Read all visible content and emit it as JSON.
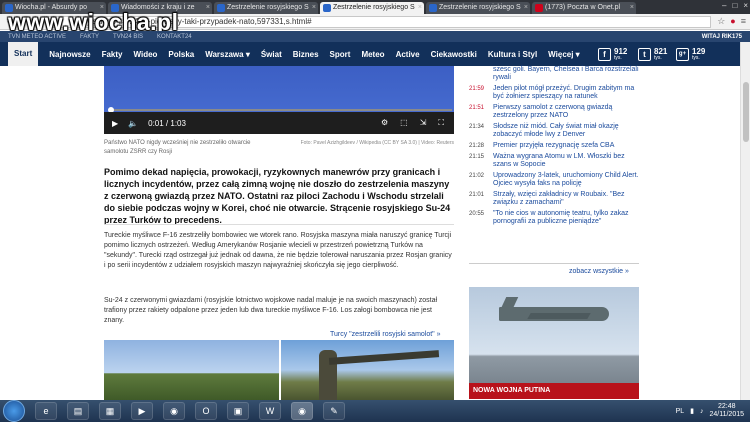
{
  "browser": {
    "tabs": [
      {
        "label": "Wiocha.pl - Absurdy po",
        "active": false
      },
      {
        "label": "Wiadomości z kraju i ze",
        "active": false
      },
      {
        "label": "Zestrzelenie rosyjskiego S",
        "active": false
      },
      {
        "label": "Zestrzelenie rosyjskiego S",
        "active": true
      },
      {
        "label": "Zestrzelenie rosyjskiego S",
        "active": false
      },
      {
        "label": "(1773) Poczta w Onet.pl",
        "active": false
      }
    ],
    "url": "yjskiego-su-24-to-pierwszy-taki-przypadek-nato,597331,s.html#"
  },
  "watermark": "www.wiocha.pl",
  "topstrip": {
    "items": [
      "TVN METEO ACTIVE",
      "FAKTY",
      "TVN24 BIS",
      "KONTAKT24"
    ],
    "greeting": "WITAJ RIK175"
  },
  "nav": {
    "start": "Start",
    "items": [
      "Najnowsze",
      "Fakty",
      "Wideo",
      "Polska",
      "Warszawa ▾",
      "Świat",
      "Biznes",
      "Sport",
      "Meteo",
      "Active",
      "Ciekawostki",
      "Kultura i Styl",
      "Więcej ▾"
    ],
    "social": [
      {
        "icon": "f",
        "count": "912",
        "unit": "tys."
      },
      {
        "icon": "t",
        "count": "821",
        "unit": "tys."
      },
      {
        "icon": "g+",
        "count": "129",
        "unit": "tys."
      }
    ]
  },
  "video": {
    "time": "0:01 / 1:03"
  },
  "caption": {
    "text": "Państwo NATO nigdy wcześniej nie zestrzeliło otwarcie samolotu ZSRR czy Rosji",
    "credit": "Foto: Pavel Azizhgildeev / Wikipedia (CC BY SA 3.0) | Video: Reuters"
  },
  "lead": "Pomimo dekad napięcia, prowokacji, ryzykownych manewrów przy granicach i licznych incydentów, przez całą zimną wojnę nie doszło do zestrzelenia maszyny z czerwoną gwiazdą przez NATO. Ostatni raz piloci Zachodu i Wschodu strzelali do siebie podczas wojny w Korei, choć nie otwarcie. Strącenie rosyjskiego Su-24 przez Turków to precedens.",
  "paragraph1": "Tureckie myśliwce F-16 zestrzeliły bombowiec we wtorek rano. Rosyjska maszyna miała naruszyć granicę Turcji pomimo licznych ostrzeżeń. Według Amerykanów Rosjanie wlecieli w przestrzeń powietrzną Turków na \"sekundy\". Turecki rząd ostrzegał już jednak od dawna, że nie będzie tolerował naruszania przez Rosjan granicy i po serii incydentów z udziałem rosyjskich maszyn najwyraźniej skończyła się jego cierpliwość.",
  "paragraph2": "Su-24 z czerwonymi gwiazdami (rosyjskie lotnictwo wojskowe nadal maluje je na swoich maszynach) został trafiony przez rakiety odpalone przez jeden lub dwa tureckie myśliwce F-16. Los załogi bombowca nie jest znany.",
  "related_link": "Turcy \"zestrzelili rosyjski samolot\" »",
  "news": [
    {
      "time": "",
      "title": "szesc goli. Bayern, Chelsea i Barca rozstrzelali rywali",
      "red": false
    },
    {
      "time": "21:59",
      "title": "Jeden pilot mógł przeżyć. Drugim zabitym ma być żołnierz spieszący na ratunek",
      "red": true
    },
    {
      "time": "21:51",
      "title": "Pierwszy samolot z czerwoną gwiazdą zestrzelony przez NATO",
      "red": true
    },
    {
      "time": "21:34",
      "title": "Słodsze niż miód. Cały świat miał okazję zobaczyć młode lwy z Denver",
      "red": false
    },
    {
      "time": "21:28",
      "title": "Premier przyjęła rezygnację szefa CBA",
      "red": false
    },
    {
      "time": "21:15",
      "title": "Ważna wygrana Atomu w LM. Włoszki bez szans w Sopocie",
      "red": false
    },
    {
      "time": "21:02",
      "title": "Uprowadzony 3-latek, uruchomiony Child Alert. Ojciec wysyła faks na policję",
      "red": false
    },
    {
      "time": "21:01",
      "title": "Strzały, wzięci zakładnicy w Roubaix. \"Bez związku z zamachami\"",
      "red": false
    },
    {
      "time": "",
      "title": "\"To nie cios w autonomię teatru, tylko zakaz pornografii za publiczne pieniądze\"",
      "red": false
    }
  ],
  "news_time_last": "20:55",
  "news_time_8": "",
  "zobacz": "zobacz wszystkie »",
  "promo_label": "NOWA WOJNA PUTINA",
  "taskbar": {
    "lang": "PL",
    "time": "22:48",
    "date": "24/11/2015"
  }
}
